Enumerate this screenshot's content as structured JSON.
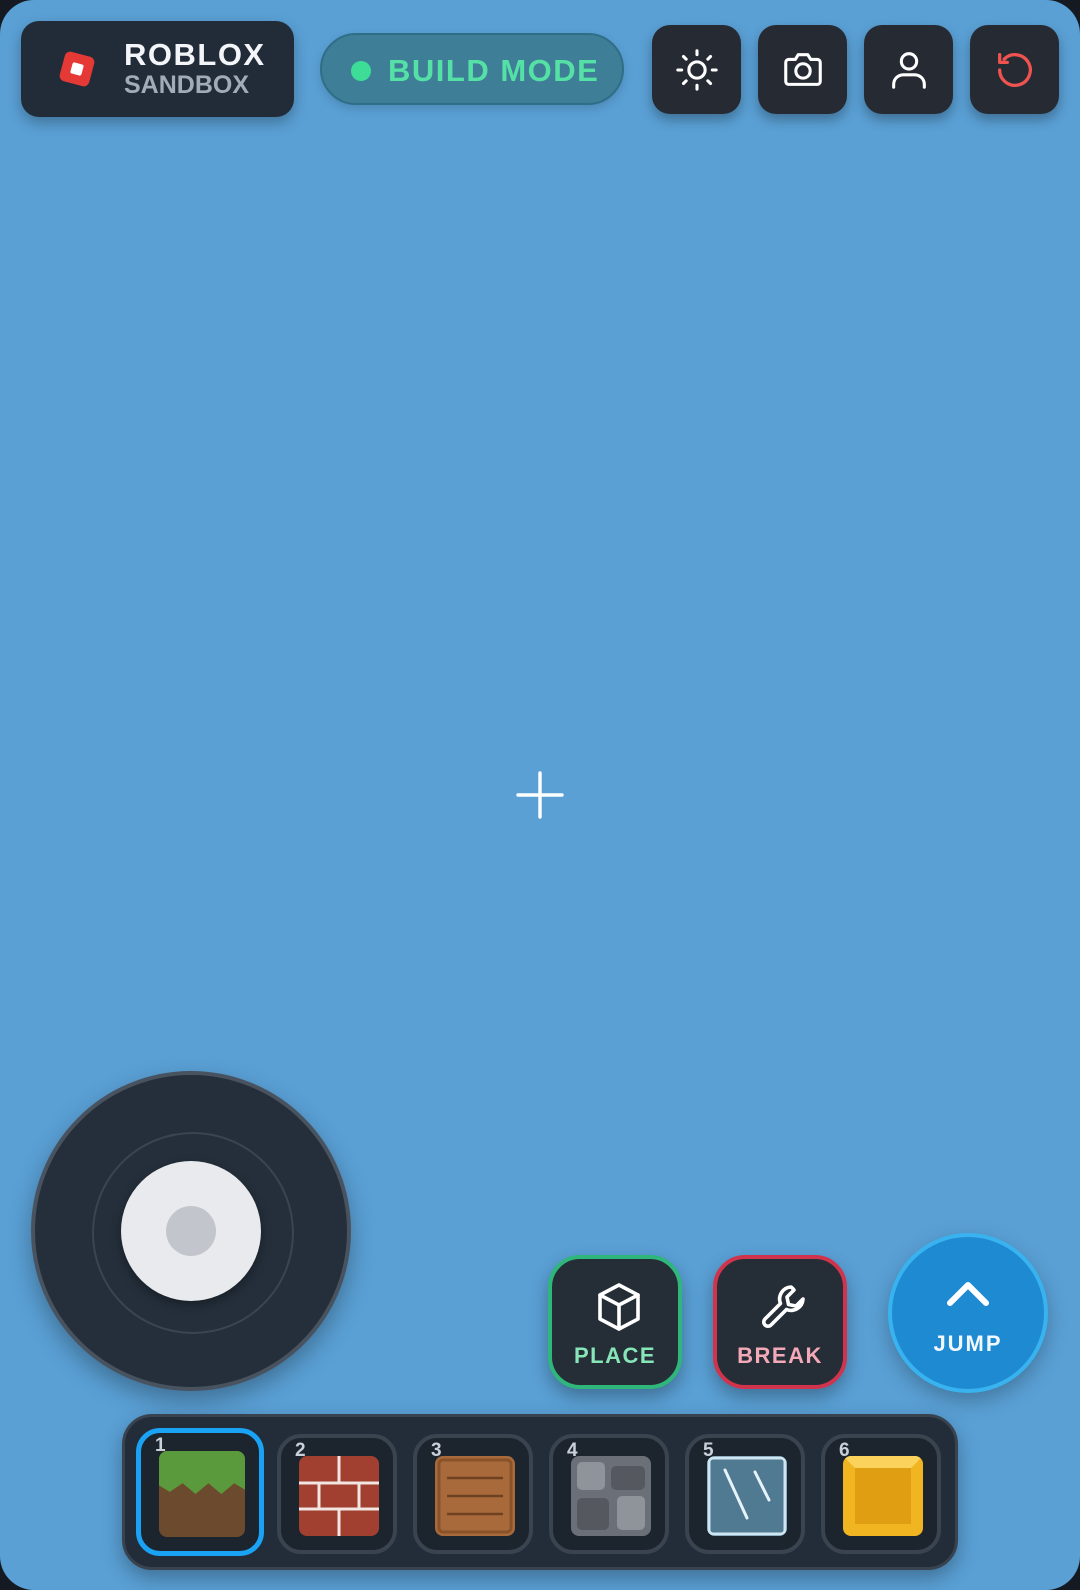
{
  "app": {
    "title": "ROBLOX",
    "subtitle": "SANDBOX"
  },
  "mode": {
    "label": "BUILD MODE",
    "status_color": "#3ddc97"
  },
  "toolbar": {
    "buttons": [
      {
        "icon": "sun-icon",
        "color": "#ffffff"
      },
      {
        "icon": "camera-icon",
        "color": "#ffffff"
      },
      {
        "icon": "user-icon",
        "color": "#ffffff"
      },
      {
        "icon": "reset-icon",
        "color": "#ef5350"
      }
    ]
  },
  "actions": {
    "place_label": "PLACE",
    "break_label": "BREAK",
    "jump_label": "JUMP"
  },
  "hotbar": {
    "selected_index": 0,
    "slots": [
      {
        "number": "1",
        "block": "grass"
      },
      {
        "number": "2",
        "block": "brick"
      },
      {
        "number": "3",
        "block": "wood"
      },
      {
        "number": "4",
        "block": "stone"
      },
      {
        "number": "5",
        "block": "glass"
      },
      {
        "number": "6",
        "block": "gold"
      }
    ]
  },
  "colors": {
    "sky": "#5aa0d5",
    "place_accent": "#2fb67a",
    "break_accent": "#d0344c",
    "jump_accent": "#1e8ad2",
    "selected_slot": "#1aa2f5"
  }
}
